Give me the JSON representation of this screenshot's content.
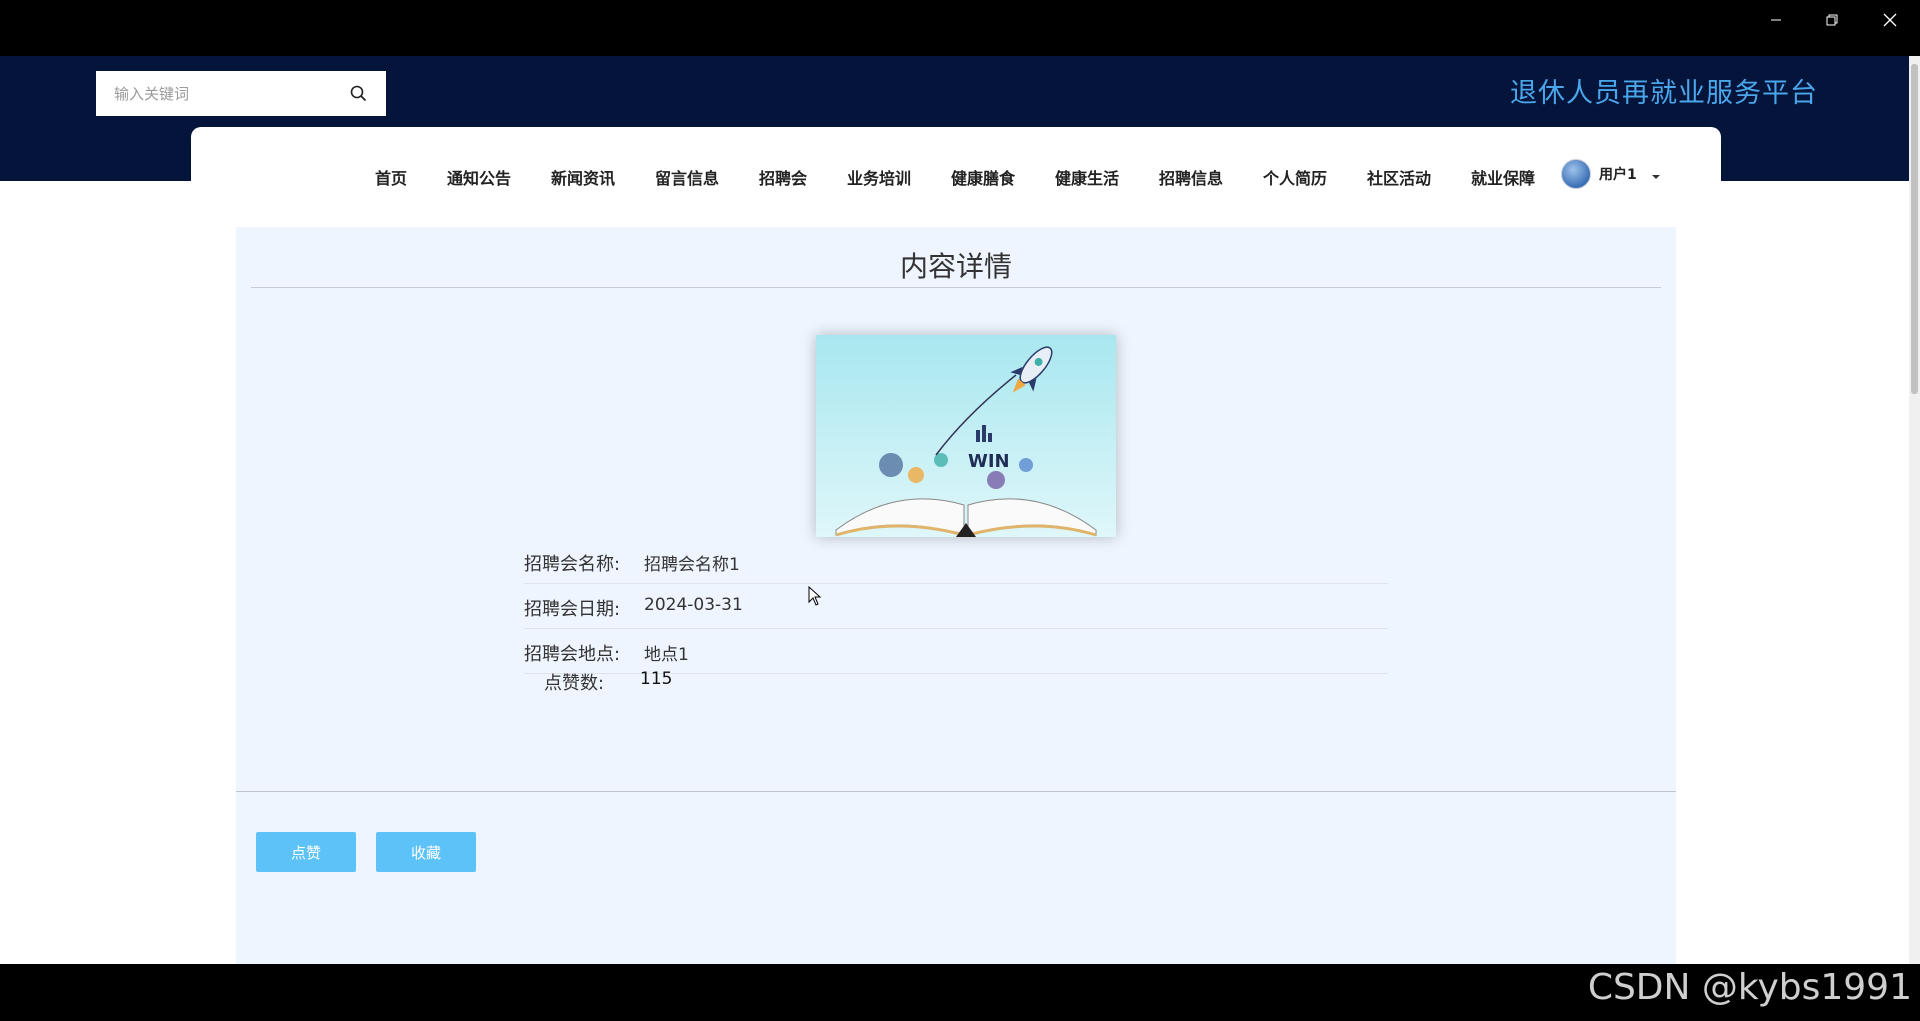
{
  "search": {
    "placeholder": "输入关键词"
  },
  "header": {
    "platform_title": "退休人员再就业服务平台"
  },
  "nav": {
    "items": [
      "首页",
      "通知公告",
      "新闻资讯",
      "留言信息",
      "招聘会",
      "业务培训",
      "健康膳食",
      "健康生活",
      "招聘信息",
      "个人简历",
      "社区活动",
      "就业保障"
    ],
    "user_name": "用户1"
  },
  "detail": {
    "title": "内容详情",
    "fields": [
      {
        "label": "招聘会名称:",
        "value": "招聘会名称1"
      },
      {
        "label": "招聘会日期:",
        "value": "2024-03-31"
      },
      {
        "label": "招聘会地点:",
        "value": "地点1"
      }
    ],
    "likes": {
      "label": "点赞数:",
      "value": "115"
    },
    "like_button": "点赞",
    "favorite_button": "收藏",
    "cover_text": "WIN"
  },
  "watermark": "CSDN @kybs1991",
  "colors": {
    "header_bg": "#04143a",
    "title_color": "#4aa6ea",
    "button_bg": "#5cc2f7",
    "panel_bg": "#eef5fe"
  }
}
